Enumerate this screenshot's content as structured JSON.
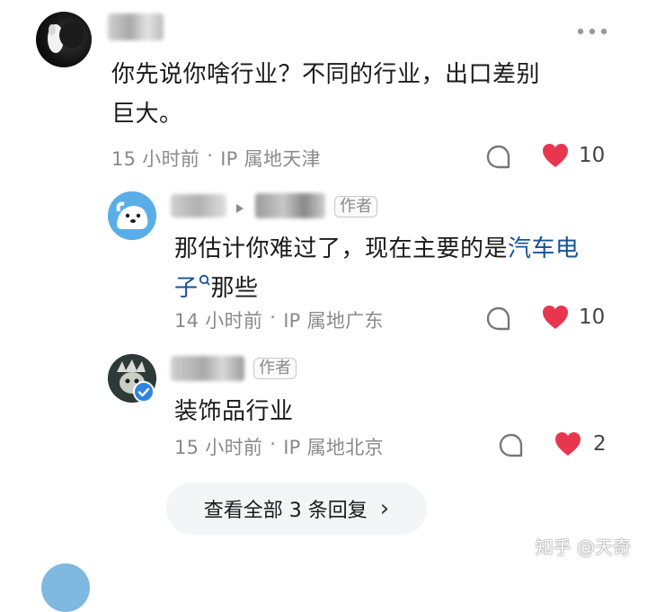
{
  "main_comment": {
    "text_line1": "你先说你啥行业？不同的行业，出口差别",
    "text_line2": "巨大。",
    "time": "15 小时前",
    "sep": "·",
    "ip": "IP 属地天津",
    "likes": "10"
  },
  "reply1": {
    "tag": "作者",
    "text_line1_prefix": "那估计你难过了，现在主要的是",
    "link_part1": "汽车电",
    "link_part2": "子",
    "text_line2_suffix": "那些",
    "time": "14 小时前",
    "sep": "·",
    "ip": "IP 属地广东",
    "likes": "10"
  },
  "reply2": {
    "tag": "作者",
    "text": "装饰品行业",
    "time": "15 小时前",
    "sep": "·",
    "ip": "IP 属地北京",
    "likes": "2"
  },
  "more_replies": {
    "label": "查看全部 3 条回复",
    "chevron": "›"
  },
  "watermark": "知乎 @天奇",
  "icons": {
    "more": "more-options-icon",
    "comment": "comment-bubble-icon",
    "like": "heart-icon"
  },
  "colors": {
    "heart": "#e8364f",
    "link": "#175199",
    "meta": "#8a8a8a"
  }
}
